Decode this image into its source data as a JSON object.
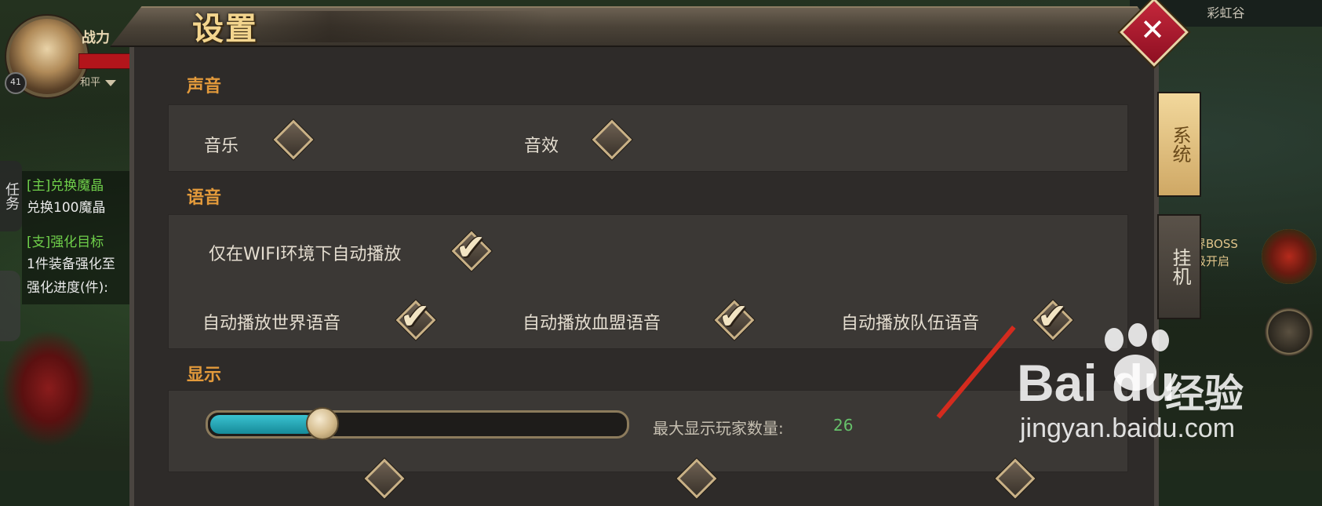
{
  "window": {
    "title": "设置",
    "close_label": "✕"
  },
  "sections": {
    "sound": {
      "title": "声音",
      "options": [
        {
          "label": "音乐",
          "checked": false
        },
        {
          "label": "音效",
          "checked": false
        }
      ]
    },
    "voice": {
      "title": "语音",
      "options": [
        {
          "label": "仅在WIFI环境下自动播放",
          "checked": true
        },
        {
          "label": "自动播放世界语音",
          "checked": true
        },
        {
          "label": "自动播放血盟语音",
          "checked": true
        },
        {
          "label": "自动播放队伍语音",
          "checked": true
        }
      ]
    },
    "display": {
      "title": "显示",
      "max_players_label": "最大显示玩家数量:",
      "max_players_value": "26",
      "slider_fraction": 0.25
    }
  },
  "side_tabs": [
    {
      "label": "系统",
      "active": true
    },
    {
      "label": "挂机",
      "active": false
    }
  ],
  "hud": {
    "power_label": "战力",
    "level": "41",
    "mode": "和平",
    "quest_tab": "任务",
    "quests": [
      {
        "text": "[主]兑换魔晶",
        "color": "green"
      },
      {
        "text": "兑换100魔晶",
        "color": "white"
      },
      {
        "text": "[支]强化目标",
        "color": "green"
      },
      {
        "text": "1件装备强化至",
        "color": "white"
      },
      {
        "text": "强化进度(件):",
        "color": "white"
      }
    ],
    "map_name": "彩虹谷",
    "boss_line1": "界BOSS",
    "boss_line2": "级开启"
  },
  "watermark": {
    "brand": "Bai du",
    "cn": "经验",
    "url": "jingyan.baidu.com"
  },
  "colors": {
    "section_title": "#e39a3b",
    "accent_teal": "#3ac2d1",
    "value_green": "#66c06a",
    "close_red": "#c4273b"
  }
}
